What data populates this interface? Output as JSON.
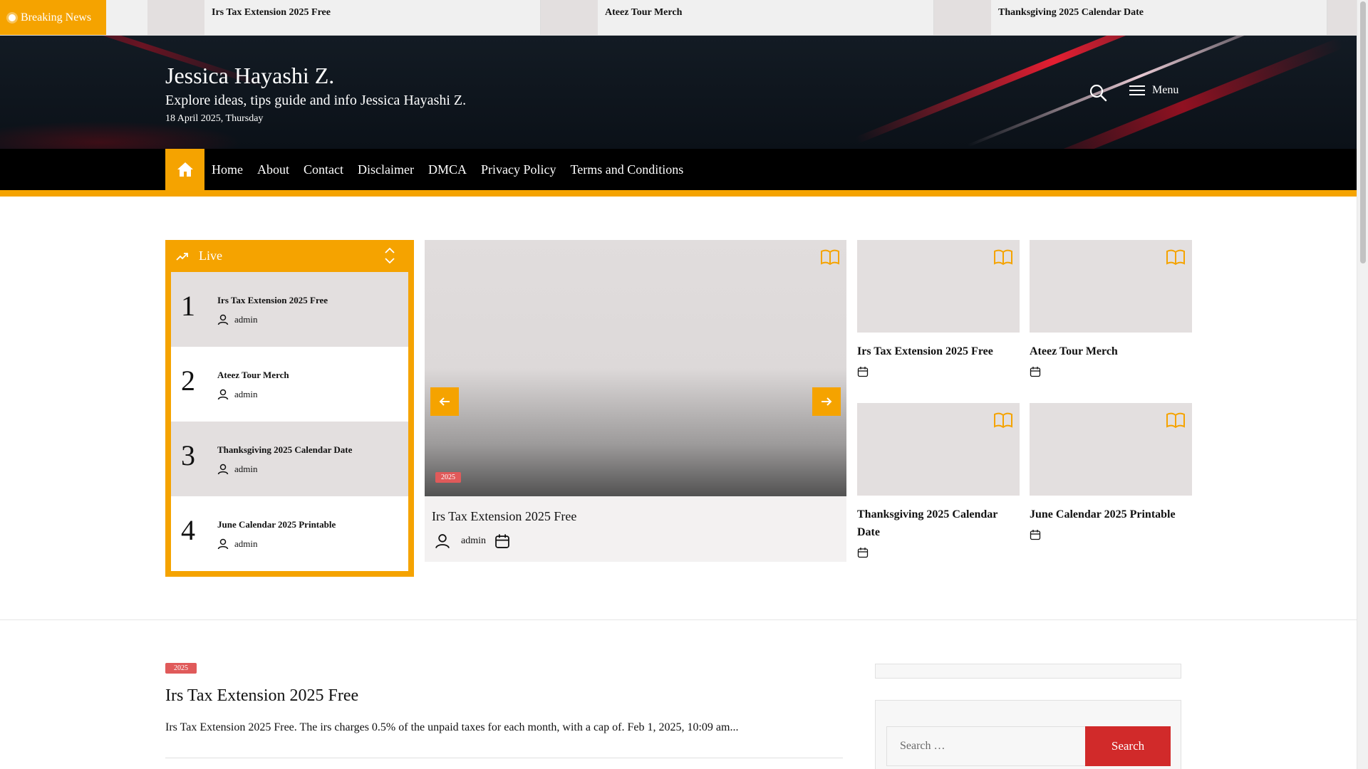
{
  "ticker": {
    "label": "Breaking News",
    "items": [
      "Irs Tax Extension 2025 Free",
      "Ateez Tour Merch",
      "Thanksgiving 2025 Calendar Date"
    ]
  },
  "header": {
    "site_title": "Jessica Hayashi Z.",
    "tagline": "Explore ideas, tips guide and info Jessica Hayashi Z.",
    "date": "18 April 2025, Thursday",
    "menu_label": "Menu"
  },
  "nav": {
    "items": [
      "Home",
      "About",
      "Contact",
      "Disclaimer",
      "DMCA",
      "Privacy Policy",
      "Terms and Conditions"
    ]
  },
  "live": {
    "title": "Live",
    "items": [
      {
        "num": "1",
        "title": "Irs Tax Extension 2025 Free",
        "author": "admin"
      },
      {
        "num": "2",
        "title": "Ateez Tour Merch",
        "author": "admin"
      },
      {
        "num": "3",
        "title": "Thanksgiving 2025 Calendar Date",
        "author": "admin"
      },
      {
        "num": "4",
        "title": "June Calendar 2025 Printable",
        "author": "admin"
      }
    ]
  },
  "slider": {
    "badge": "2025",
    "title": "Irs Tax Extension 2025 Free",
    "author": "admin"
  },
  "grid": [
    {
      "title": "Irs Tax Extension 2025 Free"
    },
    {
      "title": "Ateez Tour Merch"
    },
    {
      "title": "Thanksgiving 2025 Calendar Date"
    },
    {
      "title": "June Calendar 2025 Printable"
    }
  ],
  "post": {
    "badge": "2025",
    "title": "Irs Tax Extension 2025 Free",
    "excerpt": "Irs Tax Extension 2025 Free. The irs charges 0.5% of the unpaid taxes for each month, with a cap of. Feb 1, 2025, 10:09 am..."
  },
  "sidebar": {
    "search_placeholder": "Search …",
    "search_button": "Search"
  },
  "colors": {
    "accent": "#f5a300",
    "badge": "#e05a5a",
    "search_button": "#d12a2a",
    "nav_bg": "#000000",
    "thumb_placeholder": "#e3dfdf"
  },
  "icons": [
    "home-icon",
    "search-icon",
    "hamburger-icon",
    "trending-icon",
    "chevron-up-icon",
    "chevron-down-icon",
    "user-icon",
    "calendar-icon",
    "book-open-icon",
    "arrow-left-icon",
    "arrow-right-icon"
  ]
}
